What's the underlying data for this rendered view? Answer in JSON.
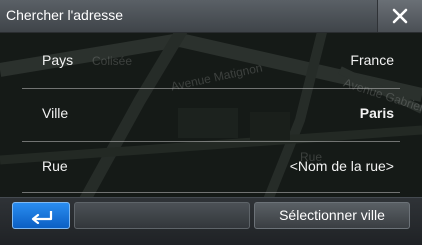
{
  "dialog": {
    "title": "Chercher l'adresse",
    "close_icon": "close-icon"
  },
  "rows": [
    {
      "label": "Pays",
      "value": "France"
    },
    {
      "label": "Ville",
      "value": "Paris"
    },
    {
      "label": "Rue",
      "value": "<Nom de la rue>"
    }
  ],
  "map": {
    "labels": [
      "Colisée",
      "Avenue Matignon",
      "Avenue Gabriel",
      "Rue"
    ]
  },
  "bottom": {
    "back_icon": "back-arrow-icon",
    "select_label": "Sélectionner ville"
  },
  "colors": {
    "accent": "#1a7ae0",
    "titlebar": "#4d5358"
  }
}
